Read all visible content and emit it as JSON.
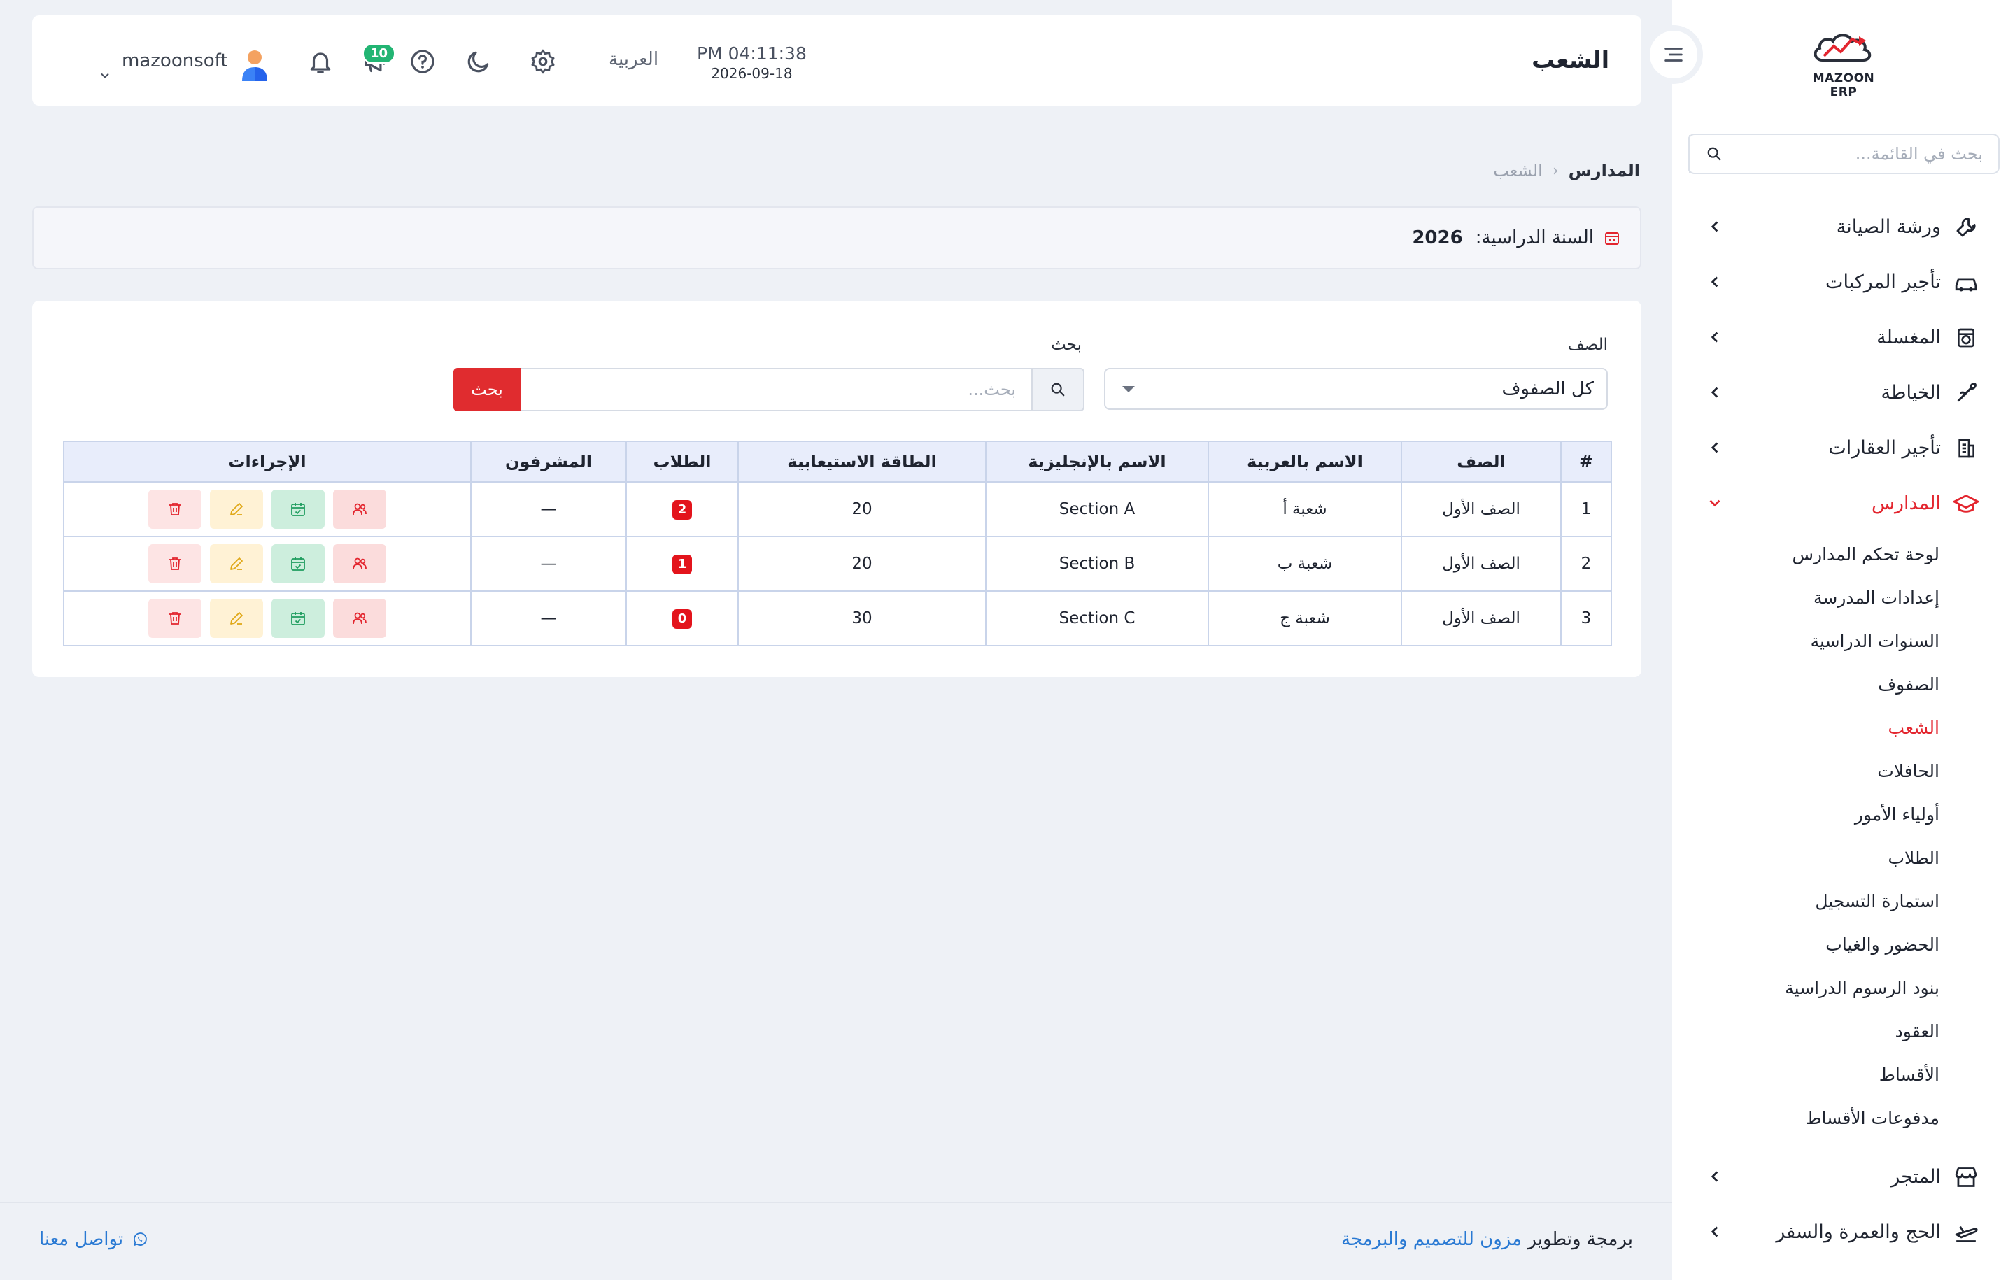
{
  "sidebar": {
    "logo_text": "MAZOON ERP",
    "search_placeholder": "بحث في القائمة...",
    "items": [
      {
        "label": "ورشة الصيانة",
        "icon": "wrench-icon"
      },
      {
        "label": "تأجير المركبات",
        "icon": "car-icon"
      },
      {
        "label": "المغسلة",
        "icon": "washer-icon"
      },
      {
        "label": "الخياطة",
        "icon": "needle-icon"
      },
      {
        "label": "تأجير العقارات",
        "icon": "building-icon"
      },
      {
        "label": "المدارس",
        "icon": "graduation-cap-icon"
      }
    ],
    "schools_submenu": [
      "لوحة تحكم المدارس",
      "إعدادات المدرسة",
      "السنوات الدراسية",
      "الصفوف",
      "الشعب",
      "الحافلات",
      "أولياء الأمور",
      "الطلاب",
      "استمارة التسجيل",
      "الحضور والغياب",
      "بنود الرسوم الدراسية",
      "العقود",
      "الأقساط",
      "مدفوعات الأقساط"
    ],
    "active_sub": "الشعب",
    "items_after": [
      {
        "label": "المتجر",
        "icon": "store-icon"
      },
      {
        "label": "الحج والعمرة والسفر",
        "icon": "plane-icon"
      }
    ],
    "accent_color": "#e3262f"
  },
  "topbar": {
    "title": "الشعب",
    "time": "PM 04:11:38",
    "date": "2026-09-18",
    "language": "العربية",
    "notification_count": "10",
    "username": "mazoonsoft"
  },
  "breadcrumb": {
    "parent": "المدارس",
    "current": "الشعب"
  },
  "academic_year": {
    "label": "السنة الدراسية:",
    "value": "2026"
  },
  "filters": {
    "grade_label": "الصف",
    "grade_value": "كل الصفوف",
    "search_label": "بحث",
    "search_placeholder": "بحث...",
    "search_button": "بحث"
  },
  "table": {
    "headers": [
      "#",
      "الصف",
      "الاسم بالعربية",
      "الاسم بالإنجليزية",
      "الطاقة الاستيعابية",
      "الطلاب",
      "المشرفون",
      "الإجراءات"
    ],
    "rows": [
      {
        "num": "1",
        "grade": "الصف الأول",
        "name_ar": "شعبة أ",
        "name_en": "Section A",
        "capacity": "20",
        "students": "2",
        "supervisors": "—"
      },
      {
        "num": "2",
        "grade": "الصف الأول",
        "name_ar": "شعبة ب",
        "name_en": "Section B",
        "capacity": "20",
        "students": "1",
        "supervisors": "—"
      },
      {
        "num": "3",
        "grade": "الصف الأول",
        "name_ar": "شعبة ج",
        "name_en": "Section C",
        "capacity": "30",
        "students": "0",
        "supervisors": "—"
      }
    ]
  },
  "footer": {
    "credit_prefix": "برمجة وتطوير",
    "credit_link": "مزون للتصميم والبرمجة",
    "contact": "تواصل معنا"
  }
}
